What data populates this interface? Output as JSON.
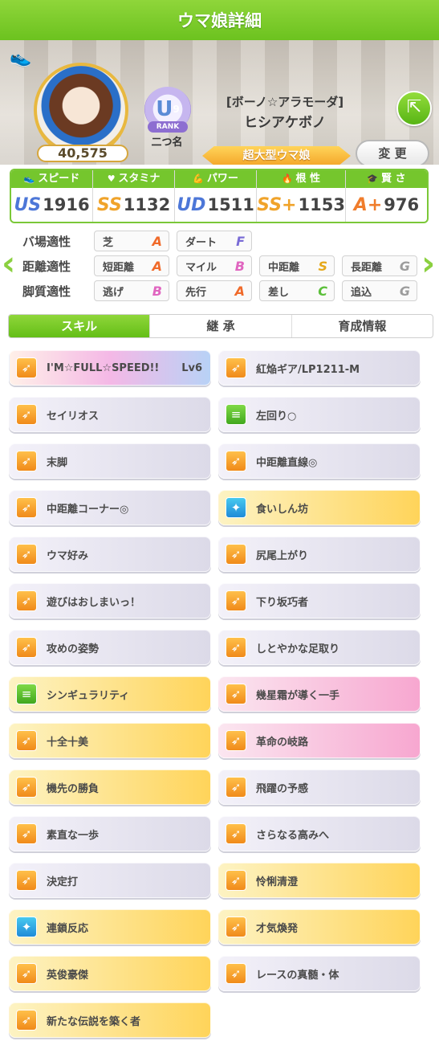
{
  "header": {
    "title": "ウマ娘詳細"
  },
  "profile": {
    "score": "40,575",
    "rank_badge": "U",
    "rank_sup": "9",
    "rank_label": "RANK",
    "nickname": "二つ名",
    "epithet": "[ボーノ☆アラモーダ]",
    "name": "ヒシアケボノ",
    "type_badge": "超大型ウマ娘",
    "change_label": "変 更",
    "title_value": "–"
  },
  "stats": [
    {
      "label": "スピード",
      "grade": "US",
      "value": "1916"
    },
    {
      "label": "スタミナ",
      "grade": "SS",
      "value": "1132"
    },
    {
      "label": "パワー",
      "grade": "UD",
      "value": "1511"
    },
    {
      "label": "根 性",
      "grade": "SS+",
      "value": "1153"
    },
    {
      "label": "賢 さ",
      "grade": "A+",
      "value": "976"
    }
  ],
  "aptitude": {
    "surface_label": "バ場適性",
    "distance_label": "距離適性",
    "style_label": "脚質適性",
    "surface": [
      {
        "name": "芝",
        "grade": "A"
      },
      {
        "name": "ダート",
        "grade": "F"
      }
    ],
    "distance": [
      {
        "name": "短距離",
        "grade": "A"
      },
      {
        "name": "マイル",
        "grade": "B"
      },
      {
        "name": "中距離",
        "grade": "S"
      },
      {
        "name": "長距離",
        "grade": "G"
      }
    ],
    "style": [
      {
        "name": "逃げ",
        "grade": "B"
      },
      {
        "name": "先行",
        "grade": "A"
      },
      {
        "name": "差し",
        "grade": "C"
      },
      {
        "name": "追込",
        "grade": "G"
      }
    ]
  },
  "tabs": [
    "スキル",
    "継 承",
    "育成情報"
  ],
  "skills": [
    {
      "name": "I'M☆FULL☆SPEED!!",
      "level": "Lv6",
      "kind": "unique",
      "icon": "orange"
    },
    {
      "name": "紅焔ギア/LP1211-M",
      "level": "",
      "kind": "normal",
      "icon": "orange"
    },
    {
      "name": "セイリオス",
      "level": "",
      "kind": "normal",
      "icon": "orange"
    },
    {
      "name": "左回り○",
      "level": "",
      "kind": "normal",
      "icon": "green"
    },
    {
      "name": "末脚",
      "level": "",
      "kind": "normal",
      "icon": "orange"
    },
    {
      "name": "中距離直線◎",
      "level": "",
      "kind": "normal",
      "icon": "orange"
    },
    {
      "name": "中距離コーナー◎",
      "level": "",
      "kind": "normal",
      "icon": "orange"
    },
    {
      "name": "食いしん坊",
      "level": "",
      "kind": "gold",
      "icon": "blue"
    },
    {
      "name": "ウマ好み",
      "level": "",
      "kind": "normal",
      "icon": "orange"
    },
    {
      "name": "尻尾上がり",
      "level": "",
      "kind": "normal",
      "icon": "orange"
    },
    {
      "name": "遊びはおしまいっ！",
      "level": "",
      "kind": "normal",
      "icon": "orange"
    },
    {
      "name": "下り坂巧者",
      "level": "",
      "kind": "normal",
      "icon": "orange"
    },
    {
      "name": "攻めの姿勢",
      "level": "",
      "kind": "normal",
      "icon": "orange"
    },
    {
      "name": "しとやかな足取り",
      "level": "",
      "kind": "normal",
      "icon": "orange"
    },
    {
      "name": "シンギュラリティ",
      "level": "",
      "kind": "gold",
      "icon": "green"
    },
    {
      "name": "幾星霜が導く一手",
      "level": "",
      "kind": "pink",
      "icon": "orange"
    },
    {
      "name": "十全十美",
      "level": "",
      "kind": "gold",
      "icon": "orange"
    },
    {
      "name": "革命の岐路",
      "level": "",
      "kind": "pink",
      "icon": "orange"
    },
    {
      "name": "機先の勝負",
      "level": "",
      "kind": "gold",
      "icon": "orange"
    },
    {
      "name": "飛躍の予感",
      "level": "",
      "kind": "normal",
      "icon": "orange"
    },
    {
      "name": "素直な一歩",
      "level": "",
      "kind": "normal",
      "icon": "orange"
    },
    {
      "name": "さらなる高みへ",
      "level": "",
      "kind": "normal",
      "icon": "orange"
    },
    {
      "name": "決定打",
      "level": "",
      "kind": "normal",
      "icon": "orange"
    },
    {
      "name": "怜悧清澄",
      "level": "",
      "kind": "gold",
      "icon": "orange"
    },
    {
      "name": "連鎖反応",
      "level": "",
      "kind": "gold",
      "icon": "blue"
    },
    {
      "name": "才気煥発",
      "level": "",
      "kind": "gold",
      "icon": "orange"
    },
    {
      "name": "英俊豪傑",
      "level": "",
      "kind": "gold",
      "icon": "orange"
    },
    {
      "name": "レースの真髄・体",
      "level": "",
      "kind": "normal",
      "icon": "orange"
    },
    {
      "name": "新たな伝説を築く者",
      "level": "",
      "kind": "gold",
      "icon": "orange"
    }
  ]
}
